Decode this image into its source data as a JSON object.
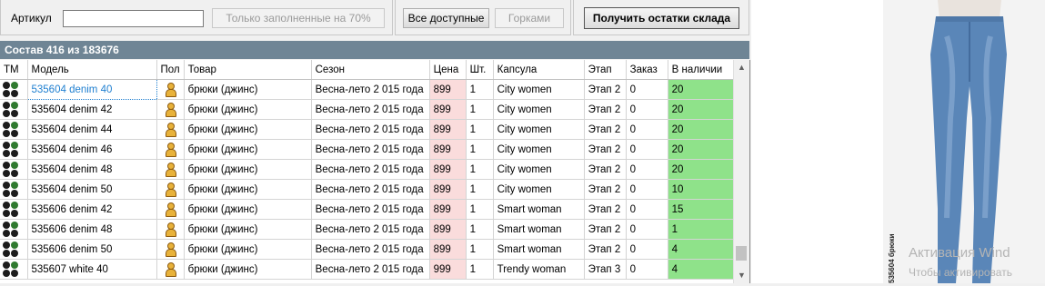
{
  "filters": {
    "article_label": "Артикул",
    "article_value": "",
    "only_filled_label": "Только заполненные на 70%",
    "all_available_label": "Все доступные",
    "gorkami_label": "Горками",
    "get_stock_label": "Получить остатки склада"
  },
  "grid": {
    "header": "Состав 416 из 183676",
    "columns": [
      "ТМ",
      "Модель",
      "Пол",
      "Товар",
      "Сезон",
      "Цена",
      "Шт.",
      "Капсула",
      "Этап",
      "Заказ",
      "В наличии"
    ],
    "rows": [
      {
        "model": "535604 denim  40",
        "product": "брюки (джинс)",
        "season": "Весна-лето 2 015 года",
        "price": "899",
        "qty": "1",
        "capsule": "City women",
        "stage": "Этап 2",
        "order": "0",
        "stock": "20"
      },
      {
        "model": "535604 denim  42",
        "product": "брюки (джинс)",
        "season": "Весна-лето 2 015 года",
        "price": "899",
        "qty": "1",
        "capsule": "City women",
        "stage": "Этап 2",
        "order": "0",
        "stock": "20"
      },
      {
        "model": "535604 denim  44",
        "product": "брюки (джинс)",
        "season": "Весна-лето 2 015 года",
        "price": "899",
        "qty": "1",
        "capsule": "City women",
        "stage": "Этап 2",
        "order": "0",
        "stock": "20"
      },
      {
        "model": "535604 denim  46",
        "product": "брюки (джинс)",
        "season": "Весна-лето 2 015 года",
        "price": "899",
        "qty": "1",
        "capsule": "City women",
        "stage": "Этап 2",
        "order": "0",
        "stock": "20"
      },
      {
        "model": "535604 denim  48",
        "product": "брюки (джинс)",
        "season": "Весна-лето 2 015 года",
        "price": "899",
        "qty": "1",
        "capsule": "City women",
        "stage": "Этап 2",
        "order": "0",
        "stock": "20"
      },
      {
        "model": "535604 denim  50",
        "product": "брюки (джинс)",
        "season": "Весна-лето 2 015 года",
        "price": "899",
        "qty": "1",
        "capsule": "City women",
        "stage": "Этап 2",
        "order": "0",
        "stock": "10"
      },
      {
        "model": "535606 denim  42",
        "product": "брюки (джинс)",
        "season": "Весна-лето 2 015 года",
        "price": "899",
        "qty": "1",
        "capsule": "Smart woman",
        "stage": "Этап 2",
        "order": "0",
        "stock": "15"
      },
      {
        "model": "535606 denim  48",
        "product": "брюки (джинс)",
        "season": "Весна-лето 2 015 года",
        "price": "899",
        "qty": "1",
        "capsule": "Smart woman",
        "stage": "Этап 2",
        "order": "0",
        "stock": "1"
      },
      {
        "model": "535606 denim  50",
        "product": "брюки (джинс)",
        "season": "Весна-лето 2 015 года",
        "price": "899",
        "qty": "1",
        "capsule": "Smart woman",
        "stage": "Этап 2",
        "order": "0",
        "stock": "4"
      },
      {
        "model": "535607 white  40",
        "product": "брюки (джинс)",
        "season": "Весна-лето 2 015 года",
        "price": "999",
        "qty": "1",
        "capsule": "Trendy woman",
        "stage": "Этап 3",
        "order": "0",
        "stock": "4"
      }
    ],
    "selected_row_index": 0
  },
  "product": {
    "photo_caption": "535604 брюки",
    "watermark_line1": "Активация Wind",
    "watermark_line2": "Чтобы активировать"
  },
  "colors": {
    "header_bar": "#6f8595",
    "price_cell": "#fadcdc",
    "stock_cell": "#8fe28a",
    "selection_text": "#1f7fd0",
    "denim": "#5a86b8"
  },
  "icons": {
    "tm": "brand-dots-icon",
    "gender": "female-user-icon",
    "scroll_up": "scroll-up-arrow-icon",
    "scroll_down": "scroll-down-arrow-icon"
  }
}
